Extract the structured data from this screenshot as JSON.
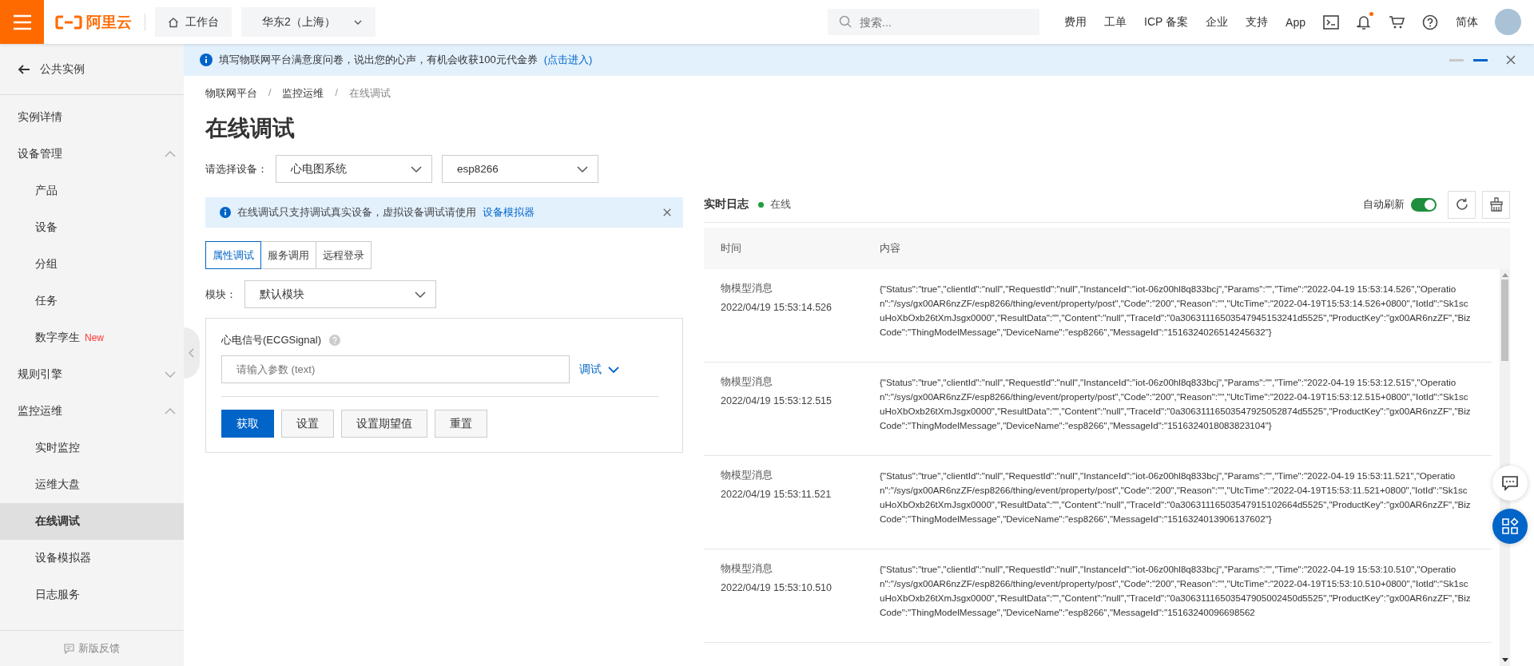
{
  "topbar": {
    "logo": "阿里云",
    "workbench": "工作台",
    "region": "华东2（上海）",
    "search": {
      "placeholder": "搜索..."
    },
    "links": [
      "费用",
      "工单",
      "ICP 备案",
      "企业",
      "支持",
      "App"
    ],
    "lang": "简体",
    "notification_dot": true
  },
  "notice": {
    "text": "填写物联网平台满意度问卷，说出您的心声，有机会收获100元代金券",
    "link": "(点击进入)",
    "pager": [
      {
        "selected": false
      },
      {
        "selected": true
      }
    ]
  },
  "sidebar": {
    "back": "公共实例",
    "items": [
      {
        "label": "实例详情",
        "selected": false
      },
      {
        "label": "设备管理",
        "expanded": true,
        "selected": false,
        "children": [
          {
            "label": "产品",
            "selected": false
          },
          {
            "label": "设备",
            "selected": false
          },
          {
            "label": "分组",
            "selected": false
          },
          {
            "label": "任务",
            "selected": false
          },
          {
            "label": "数字孪生",
            "badge": "New",
            "selected": false
          }
        ]
      },
      {
        "label": "规则引擎",
        "expanded": false,
        "selected": false
      },
      {
        "label": "监控运维",
        "expanded": true,
        "selected": false,
        "children": [
          {
            "label": "实时监控",
            "selected": false
          },
          {
            "label": "运维大盘",
            "selected": false
          },
          {
            "label": "在线调试",
            "selected": true
          },
          {
            "label": "设备模拟器",
            "selected": false
          },
          {
            "label": "日志服务",
            "selected": false
          }
        ]
      }
    ],
    "feedback": "新版反馈"
  },
  "breadcrumb": {
    "separator": "/",
    "items": [
      "物联网平台",
      "监控运维",
      "在线调试"
    ]
  },
  "title": "在线调试",
  "device_select": {
    "label": "请选择设备：",
    "product": "心电图系统",
    "device": "esp8266"
  },
  "alert": {
    "text": "在线调试只支持调试真实设备，虚拟设备调试请使用",
    "link": "设备模拟器"
  },
  "tabs": [
    {
      "label": "属性调试",
      "selected": true
    },
    {
      "label": "服务调用",
      "selected": false
    },
    {
      "label": "远程登录",
      "selected": false
    }
  ],
  "module": {
    "label": "模块：",
    "value": "默认模块"
  },
  "property": {
    "name": "心电信号(ECGSignal)",
    "placeholder": "请输入参数 (text)",
    "debug": "调试"
  },
  "buttons": [
    {
      "label": "获取",
      "kind": "primary"
    },
    {
      "label": "设置",
      "kind": "normal"
    },
    {
      "label": "设置期望值",
      "kind": "normal"
    },
    {
      "label": "重置",
      "kind": "normal"
    }
  ],
  "log": {
    "title": "实时日志",
    "status": "在线",
    "online": true,
    "auto_refresh": {
      "label": "自动刷新",
      "on": true
    },
    "columns": [
      "时间",
      "内容"
    ],
    "rows": [
      {
        "type": "物模型消息",
        "time": "2022/04/19 15:53:14.526",
        "content": "{\"Status\":\"true\",\"clientId\":\"null\",\"RequestId\":\"null\",\"InstanceId\":\"iot-06z00hl8q833bcj\",\"Params\":\"\",\"Time\":\"2022-04-19 15:53:14.526\",\"Operation\":\"/sys/gx00AR6nzZF/esp8266/thing/event/property/post\",\"Code\":\"200\",\"Reason\":\"\",\"UtcTime\":\"2022-04-19T15:53:14.526+0800\",\"IotId\":\"Sk1scuHoXbOxb26tXmJsgx0000\",\"ResultData\":\"\",\"Content\":\"null\",\"TraceId\":\"0a30631116503547945153241d5525\",\"ProductKey\":\"gx00AR6nzZF\",\"BizCode\":\"ThingModelMessage\",\"DeviceName\":\"esp8266\",\"MessageId\":\"1516324026514245632\"}"
      },
      {
        "type": "物模型消息",
        "time": "2022/04/19 15:53:12.515",
        "content": "{\"Status\":\"true\",\"clientId\":\"null\",\"RequestId\":\"null\",\"InstanceId\":\"iot-06z00hl8q833bcj\",\"Params\":\"\",\"Time\":\"2022-04-19 15:53:12.515\",\"Operation\":\"/sys/gx00AR6nzZF/esp8266/thing/event/property/post\",\"Code\":\"200\",\"Reason\":\"\",\"UtcTime\":\"2022-04-19T15:53:12.515+0800\",\"IotId\":\"Sk1scuHoXbOxb26tXmJsgx0000\",\"ResultData\":\"\",\"Content\":\"null\",\"TraceId\":\"0a30631116503547925052874d5525\",\"ProductKey\":\"gx00AR6nzZF\",\"BizCode\":\"ThingModelMessage\",\"DeviceName\":\"esp8266\",\"MessageId\":\"1516324018083823104\"}"
      },
      {
        "type": "物模型消息",
        "time": "2022/04/19 15:53:11.521",
        "content": "{\"Status\":\"true\",\"clientId\":\"null\",\"RequestId\":\"null\",\"InstanceId\":\"iot-06z00hl8q833bcj\",\"Params\":\"\",\"Time\":\"2022-04-19 15:53:11.521\",\"Operation\":\"/sys/gx00AR6nzZF/esp8266/thing/event/property/post\",\"Code\":\"200\",\"Reason\":\"\",\"UtcTime\":\"2022-04-19T15:53:11.521+0800\",\"IotId\":\"Sk1scuHoXbOxb26tXmJsgx0000\",\"ResultData\":\"\",\"Content\":\"null\",\"TraceId\":\"0a30631116503547915102664d5525\",\"ProductKey\":\"gx00AR6nzZF\",\"BizCode\":\"ThingModelMessage\",\"DeviceName\":\"esp8266\",\"MessageId\":\"1516324013906137602\"}"
      },
      {
        "type": "物模型消息",
        "time": "2022/04/19 15:53:10.510",
        "content": "{\"Status\":\"true\",\"clientId\":\"null\",\"RequestId\":\"null\",\"InstanceId\":\"iot-06z00hl8q833bcj\",\"Params\":\"\",\"Time\":\"2022-04-19 15:53:10.510\",\"Operation\":\"/sys/gx00AR6nzZF/esp8266/thing/event/property/post\",\"Code\":\"200\",\"Reason\":\"\",\"UtcTime\":\"2022-04-19T15:53:10.510+0800\",\"IotId\":\"Sk1scuHoXbOxb26tXmJsgx0000\",\"ResultData\":\"\",\"Content\":\"null\",\"TraceId\":\"0a30631116503547905002450d5525\",\"ProductKey\":\"gx00AR6nzZF\",\"BizCode\":\"ThingModelMessage\",\"DeviceName\":\"esp8266\",\"MessageId\":\"15163240096698562"
      }
    ]
  }
}
